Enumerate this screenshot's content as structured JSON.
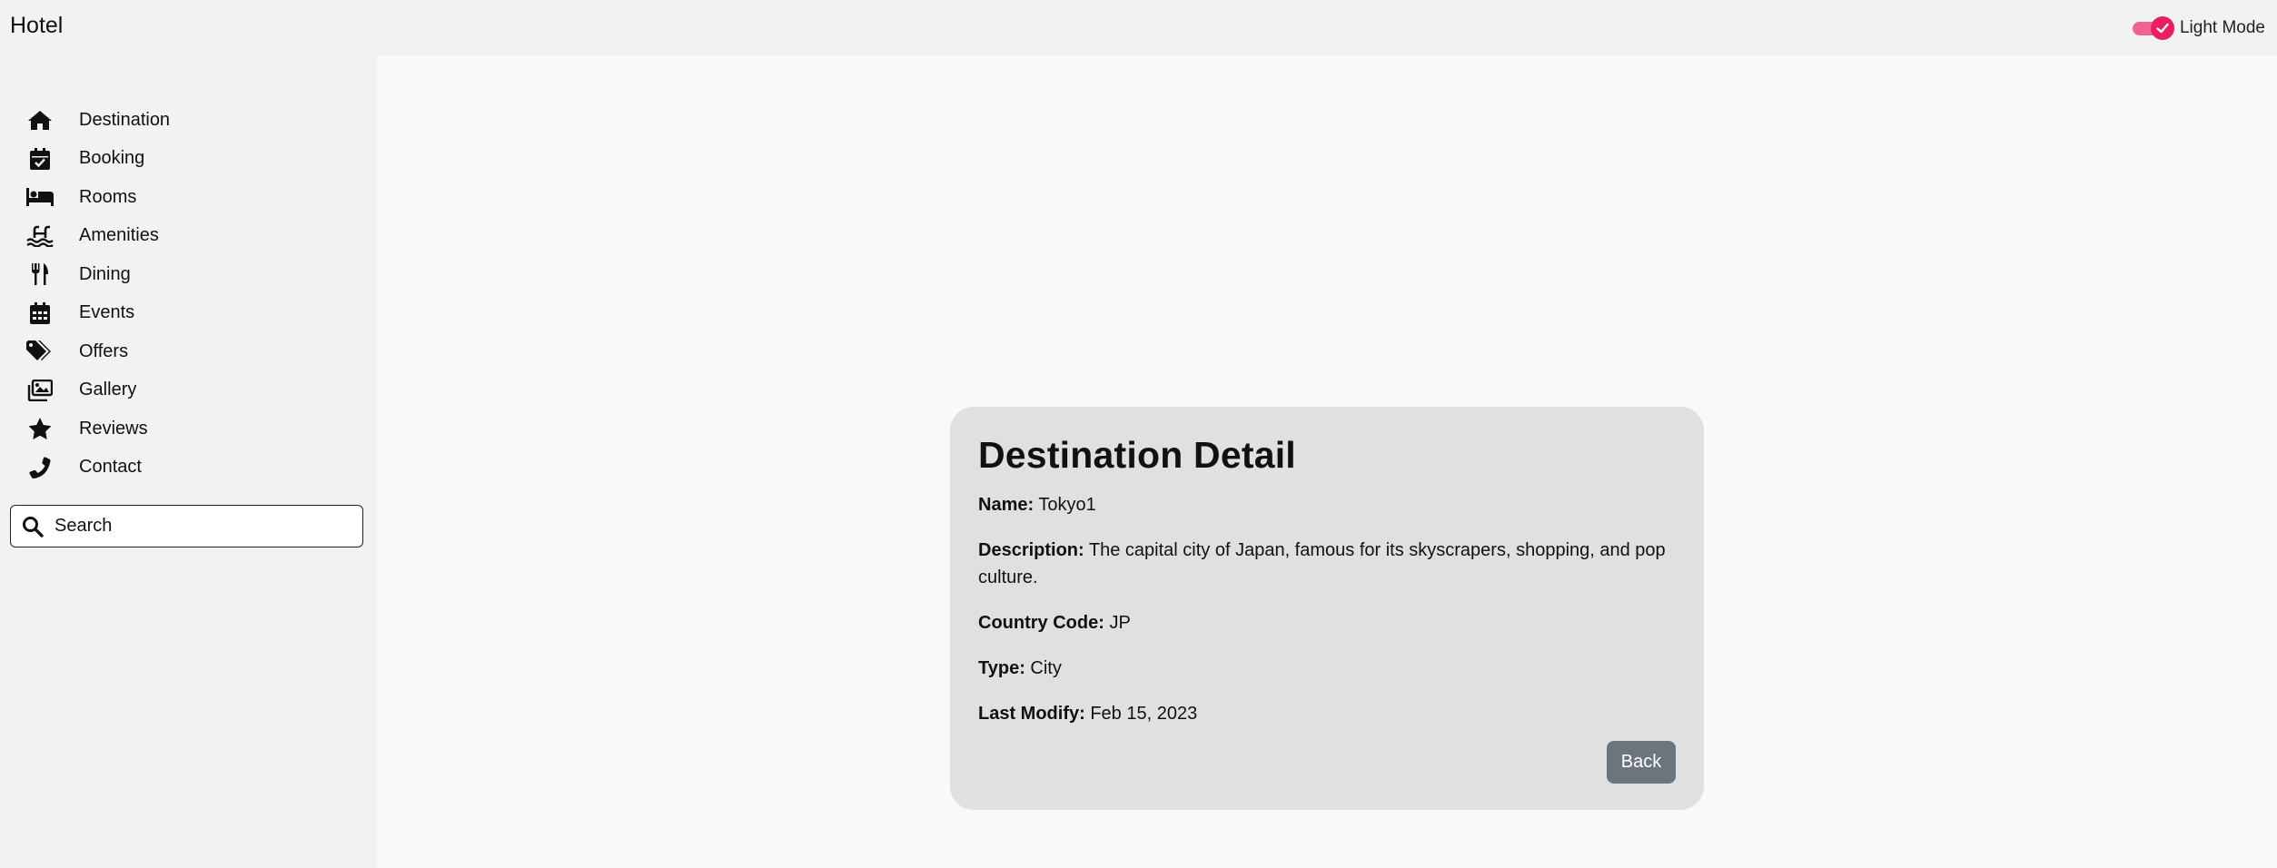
{
  "app": {
    "title": "Hotel"
  },
  "theme_toggle": {
    "label": "Light Mode",
    "checked": true,
    "accent": "#e91e63"
  },
  "sidebar": {
    "items": [
      {
        "label": "Destination",
        "icon": "home-icon"
      },
      {
        "label": "Booking",
        "icon": "calendar-check-icon"
      },
      {
        "label": "Rooms",
        "icon": "bed-icon"
      },
      {
        "label": "Amenities",
        "icon": "pool-icon"
      },
      {
        "label": "Dining",
        "icon": "utensils-icon"
      },
      {
        "label": "Events",
        "icon": "calendar-icon"
      },
      {
        "label": "Offers",
        "icon": "tags-icon"
      },
      {
        "label": "Gallery",
        "icon": "images-icon"
      },
      {
        "label": "Reviews",
        "icon": "star-icon"
      },
      {
        "label": "Contact",
        "icon": "phone-icon"
      }
    ],
    "search": {
      "placeholder": "Search",
      "value": ""
    }
  },
  "detail": {
    "title": "Destination Detail",
    "fields": [
      {
        "label": "Name:",
        "value": "Tokyo1"
      },
      {
        "label": "Description:",
        "value": "The capital city of Japan, famous for its skyscrapers, shopping, and pop culture."
      },
      {
        "label": "Country Code:",
        "value": "JP"
      },
      {
        "label": "Type:",
        "value": "City"
      },
      {
        "label": "Last Modify:",
        "value": "Feb 15, 2023"
      }
    ],
    "back_label": "Back"
  }
}
